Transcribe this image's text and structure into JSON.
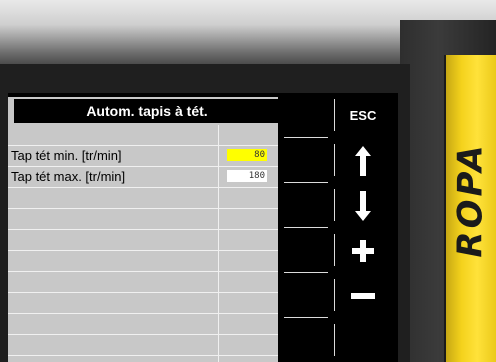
{
  "brand": {
    "name": "ROPA",
    "color": "#f4d21c"
  },
  "window": {
    "title": "Autom. tapis à tét."
  },
  "parameters": [
    {
      "label": "Tap tét min. [tr/min]",
      "value": "80",
      "highlighted": true
    },
    {
      "label": "Tap tét max. [tr/min]",
      "value": "180",
      "highlighted": false
    }
  ],
  "empty_rows": 9,
  "softkeys": [
    {
      "label": "ESC",
      "icon": "esc-label"
    },
    {
      "label": "",
      "icon": "arrow-up-icon"
    },
    {
      "label": "",
      "icon": "arrow-down-icon"
    },
    {
      "label": "",
      "icon": "plus-icon"
    },
    {
      "label": "",
      "icon": "minus-icon"
    },
    {
      "label": "",
      "icon": ""
    }
  ],
  "colors": {
    "highlight": "#ffff00",
    "panel_bg": "#c8c8c8",
    "title_bg": "#000000"
  }
}
